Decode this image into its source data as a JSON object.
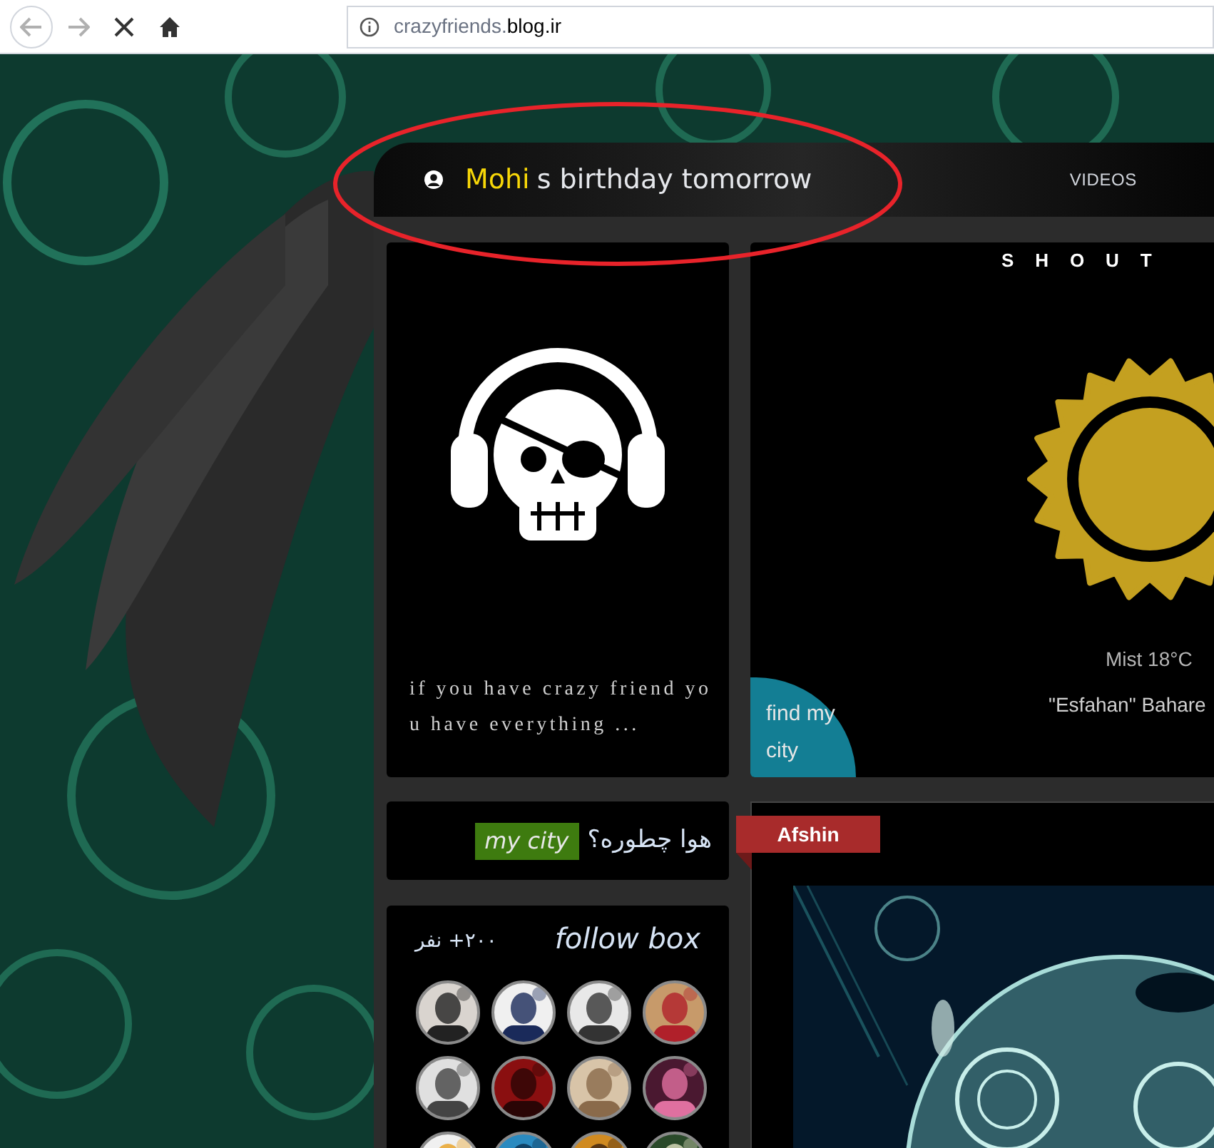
{
  "browser": {
    "url": {
      "subdomain": "crazyfriends.",
      "domain": "blog.ir"
    }
  },
  "header": {
    "birthday_name": "Mohi",
    "birthday_text": "s birthday tomorrow",
    "nav": [
      "VIDEOS"
    ]
  },
  "quote": {
    "lines": [
      "if you have crazy friend yo",
      "u have everything ..."
    ]
  },
  "weather": {
    "title": "SHOUT",
    "condition": "Mist 18°C",
    "location": "\"Esfahan\" Bahare",
    "find_button": "find my city"
  },
  "city_widget": {
    "badge": "my city",
    "question": "هوا چطوره؟"
  },
  "follow_box": {
    "title": "follow box",
    "count": "۲۰۰+ نفر"
  },
  "post": {
    "author": "Afshin"
  }
}
